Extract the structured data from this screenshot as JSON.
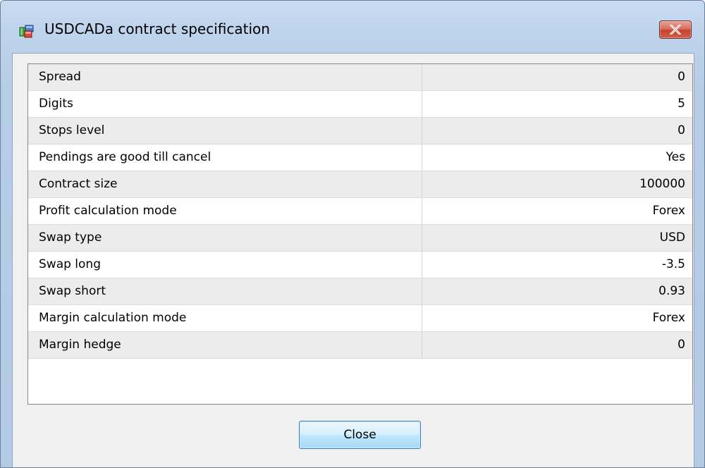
{
  "window": {
    "title": "USDCADa contract specification"
  },
  "spec_table": {
    "rows": [
      {
        "name": "Spread",
        "value": "0"
      },
      {
        "name": "Digits",
        "value": "5"
      },
      {
        "name": "Stops level",
        "value": "0"
      },
      {
        "name": "Pendings are good till cancel",
        "value": "Yes"
      },
      {
        "name": "Contract size",
        "value": "100000"
      },
      {
        "name": "Profit calculation mode",
        "value": "Forex"
      },
      {
        "name": "Swap type",
        "value": "USD"
      },
      {
        "name": "Swap long",
        "value": "-3.5"
      },
      {
        "name": "Swap short",
        "value": "0.93"
      },
      {
        "name": "Margin calculation mode",
        "value": "Forex"
      },
      {
        "name": "Margin hedge",
        "value": "0"
      }
    ]
  },
  "footer": {
    "close_label": "Close"
  },
  "icons": {
    "app": "contract-spec-icon",
    "window_close": "close-x-icon"
  },
  "colors": {
    "title_bar": "#bfd4ec",
    "close_button_red": "#c7412c",
    "row_alt": "#ececec",
    "button_blue": "#bee6fd"
  }
}
